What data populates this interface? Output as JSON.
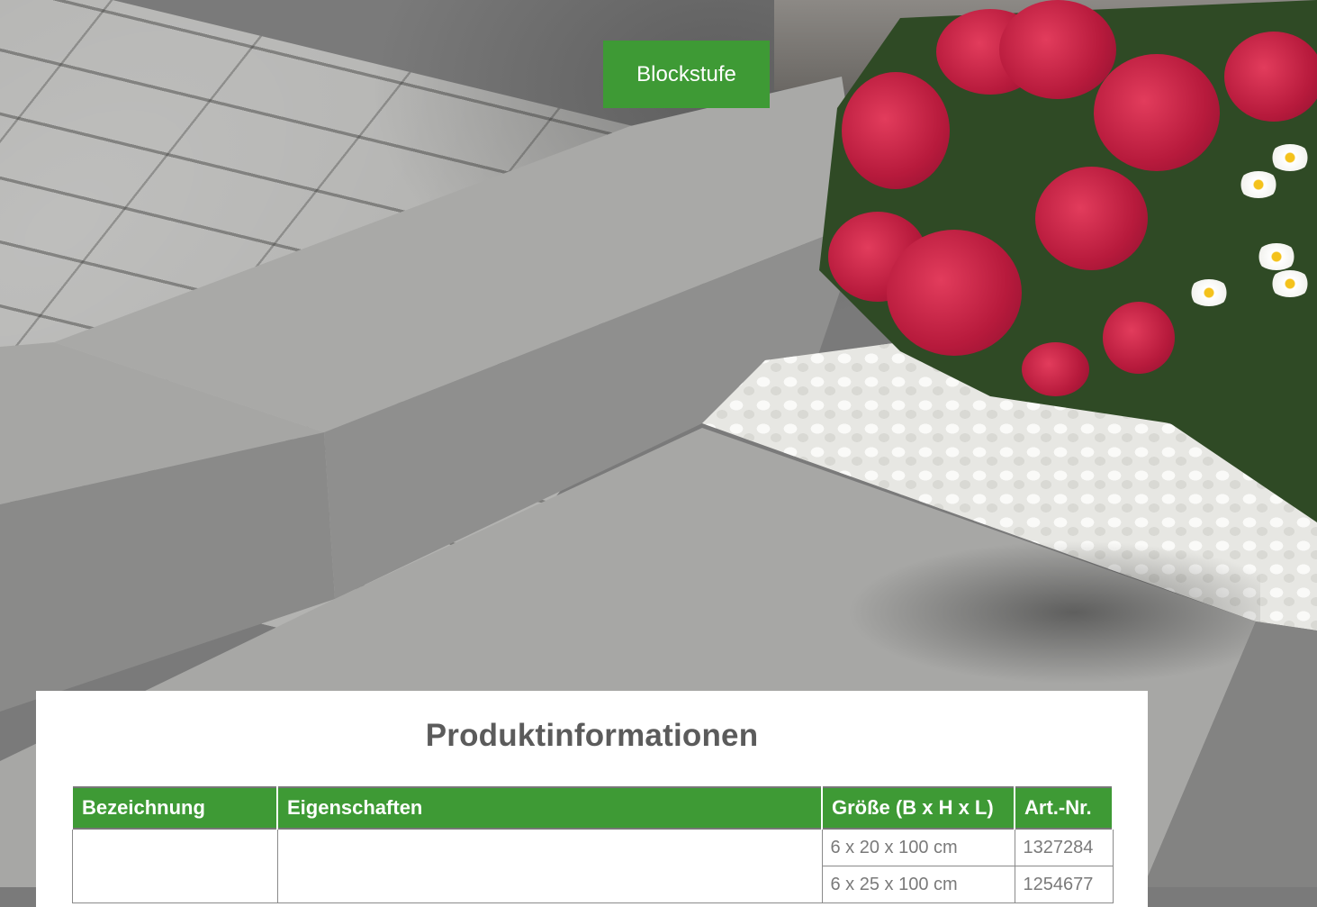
{
  "badge": {
    "label": "Blockstufe"
  },
  "panel": {
    "title": "Produktinformationen",
    "table": {
      "headers": [
        "Bezeichnung",
        "Eigenschaften",
        "Größe (B x H x L)",
        "Art.-Nr."
      ],
      "rows": [
        {
          "size": "6 x 20 x 100 cm",
          "art_nr": "1327284"
        },
        {
          "size": "6 x 25 x 100 cm",
          "art_nr": "1254677"
        }
      ]
    }
  },
  "colors": {
    "brand_green": "#3e9a35",
    "title_gray": "#5b5b5b",
    "cell_text": "#7a7a7a"
  }
}
